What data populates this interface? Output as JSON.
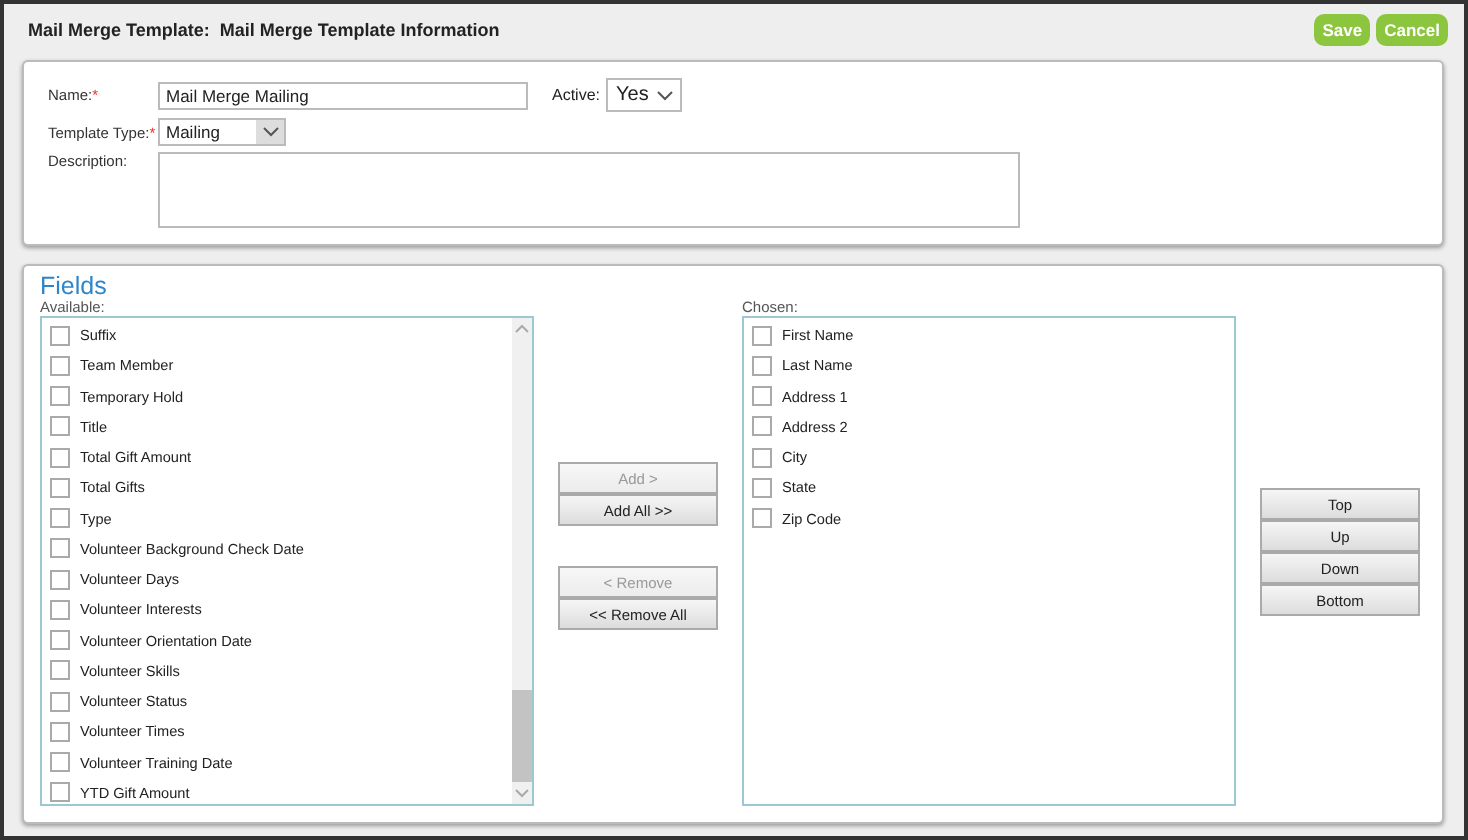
{
  "header": {
    "title": "Mail Merge Template:  Mail Merge Template Information",
    "buttons": [
      {
        "label": "Save"
      },
      {
        "label": "Cancel"
      }
    ]
  },
  "form": {
    "name": {
      "label": "Name:",
      "required_mark": "*",
      "value": "Mail Merge Mailing"
    },
    "active": {
      "label": "Active:",
      "value": "Yes"
    },
    "template_type": {
      "label": "Template Type:",
      "required_mark": "*",
      "value": "Mailing"
    },
    "description": {
      "label": "Description:"
    }
  },
  "fields": {
    "title": "Fields",
    "available": {
      "label": "Available:",
      "items": [
        {
          "label": "Suffix",
          "checked": false
        },
        {
          "label": "Team Member",
          "checked": false
        },
        {
          "label": "Temporary Hold",
          "checked": false
        },
        {
          "label": "Title",
          "checked": false
        },
        {
          "label": "Total Gift Amount",
          "checked": false
        },
        {
          "label": "Total Gifts",
          "checked": false
        },
        {
          "label": "Type",
          "checked": false
        },
        {
          "label": "Volunteer Background Check Date",
          "checked": false
        },
        {
          "label": "Volunteer Days",
          "checked": false
        },
        {
          "label": "Volunteer Interests",
          "checked": false
        },
        {
          "label": "Volunteer Orientation Date",
          "checked": false
        },
        {
          "label": "Volunteer Skills",
          "checked": false
        },
        {
          "label": "Volunteer Status",
          "checked": false
        },
        {
          "label": "Volunteer Times",
          "checked": false
        },
        {
          "label": "Volunteer Training Date",
          "checked": false
        },
        {
          "label": "YTD Gift Amount",
          "checked": false
        }
      ]
    },
    "transfer_buttons": [
      {
        "label": "Add >",
        "disabled": true
      },
      {
        "label": "Add All >>",
        "disabled": false
      },
      {
        "label": "< Remove",
        "disabled": true
      },
      {
        "label": "<< Remove All",
        "disabled": false
      }
    ],
    "chosen": {
      "label": "Chosen:",
      "items": [
        {
          "label": "First Name",
          "checked": false
        },
        {
          "label": "Last Name",
          "checked": false
        },
        {
          "label": "Address 1",
          "checked": false
        },
        {
          "label": "Address 2",
          "checked": false
        },
        {
          "label": "City",
          "checked": false
        },
        {
          "label": "State",
          "checked": false
        },
        {
          "label": "Zip Code",
          "checked": false
        }
      ]
    },
    "order_buttons": [
      {
        "label": "Top"
      },
      {
        "label": "Up"
      },
      {
        "label": "Down"
      },
      {
        "label": "Bottom"
      }
    ]
  }
}
